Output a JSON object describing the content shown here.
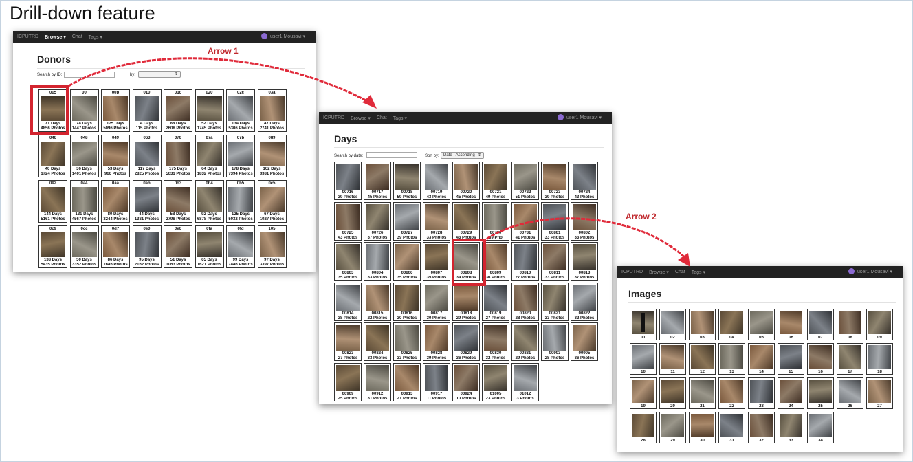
{
  "slide": {
    "title": "Drill-down feature",
    "arrow1": "Arrow 1",
    "arrow2": "Arrow 2"
  },
  "nav": {
    "brand": "ICPUTRD",
    "browse": "Browse ▾",
    "chat": "Chat",
    "tags": "Tags ▾",
    "user": "user1 Mousavi ▾"
  },
  "donors": {
    "title": "Donors",
    "search_label": "Search by ID:",
    "sort_label": "by:",
    "items": [
      {
        "id": "005",
        "days": "71 Days",
        "photos": "4856 Photos"
      },
      {
        "id": "00",
        "days": "74 Days",
        "photos": "1447 Photos"
      },
      {
        "id": "00b",
        "days": "175 Days",
        "photos": "5096 Photos"
      },
      {
        "id": "010",
        "days": "4 Days",
        "photos": "115 Photos"
      },
      {
        "id": "01c",
        "days": "88 Days",
        "photos": "2608 Photos"
      },
      {
        "id": "020",
        "days": "52 Days",
        "photos": "1745 Photos"
      },
      {
        "id": "02c",
        "days": "134 Days",
        "photos": "5306 Photos"
      },
      {
        "id": "03a",
        "days": "47 Days",
        "photos": "2741 Photos"
      },
      {
        "id": "046",
        "days": "40 Days",
        "photos": "1724 Photos"
      },
      {
        "id": "048",
        "days": "36 Days",
        "photos": "1401 Photos"
      },
      {
        "id": "049",
        "days": "53 Days",
        "photos": "966 Photos"
      },
      {
        "id": "063",
        "days": "117 Days",
        "photos": "2825 Photos"
      },
      {
        "id": "070",
        "days": "175 Days",
        "photos": "5631 Photos"
      },
      {
        "id": "07a",
        "days": "64 Days",
        "photos": "1832 Photos"
      },
      {
        "id": "07b",
        "days": "178 Days",
        "photos": "7394 Photos"
      },
      {
        "id": "089",
        "days": "102 Days",
        "photos": "3381 Photos"
      },
      {
        "id": "092",
        "days": "144 Days",
        "photos": "5161 Photos"
      },
      {
        "id": "0a4",
        "days": "131 Days",
        "photos": "4567 Photos"
      },
      {
        "id": "0aa",
        "days": "80 Days",
        "photos": "3244 Photos"
      },
      {
        "id": "0ab",
        "days": "44 Days",
        "photos": "1381 Photos"
      },
      {
        "id": "0b3",
        "days": "58 Days",
        "photos": "2798 Photos"
      },
      {
        "id": "0b4",
        "days": "92 Days",
        "photos": "6878 Photos"
      },
      {
        "id": "0b5",
        "days": "125 Days",
        "photos": "5032 Photos"
      },
      {
        "id": "0c5",
        "days": "67 Days",
        "photos": "1027 Photos"
      },
      {
        "id": "0c9",
        "days": "138 Days",
        "photos": "5435 Photos"
      },
      {
        "id": "0cc",
        "days": "50 Days",
        "photos": "3352 Photos"
      },
      {
        "id": "0d7",
        "days": "86 Days",
        "photos": "1645 Photos"
      },
      {
        "id": "0e0",
        "days": "95 Days",
        "photos": "2162 Photos"
      },
      {
        "id": "0e6",
        "days": "51 Days",
        "photos": "1063 Photos"
      },
      {
        "id": "0fa",
        "days": "65 Days",
        "photos": "1621 Photos"
      },
      {
        "id": "0fd",
        "days": "99 Days",
        "photos": "7446 Photos"
      },
      {
        "id": "105",
        "days": "97 Days",
        "photos": "3397 Photos"
      }
    ]
  },
  "days": {
    "title": "Days",
    "search_label": "Search by date:",
    "sort_label": "Sort by:",
    "sort_value": "Date - Ascending",
    "items": [
      {
        "date": "00716",
        "photos": "39 Photos"
      },
      {
        "date": "00717",
        "photos": "45 Photos"
      },
      {
        "date": "00718",
        "photos": "59 Photos"
      },
      {
        "date": "00719",
        "photos": "43 Photos"
      },
      {
        "date": "00720",
        "photos": "45 Photos"
      },
      {
        "date": "00721",
        "photos": "49 Photos"
      },
      {
        "date": "00722",
        "photos": "51 Photos"
      },
      {
        "date": "00723",
        "photos": "39 Photos"
      },
      {
        "date": "00724",
        "photos": "43 Photos"
      },
      {
        "date": "00725",
        "photos": "43 Photos"
      },
      {
        "date": "00726",
        "photos": "37 Photos"
      },
      {
        "date": "00727",
        "photos": "39 Photos"
      },
      {
        "date": "00728",
        "photos": "33 Photos"
      },
      {
        "date": "00729",
        "photos": "43 Photos"
      },
      {
        "date": "00730",
        "photos": "39 Pho"
      },
      {
        "date": "00731",
        "photos": "41 Photos"
      },
      {
        "date": "00801",
        "photos": "33 Photos"
      },
      {
        "date": "00802",
        "photos": "33 Photos"
      },
      {
        "date": "00803",
        "photos": "35 Photos"
      },
      {
        "date": "00804",
        "photos": "33 Photos"
      },
      {
        "date": "00806",
        "photos": "35 Photos"
      },
      {
        "date": "00807",
        "photos": "35 Photos"
      },
      {
        "date": "00808",
        "photos": "34 Photos"
      },
      {
        "date": "00809",
        "photos": "36 Photos"
      },
      {
        "date": "00810",
        "photos": "27 Photos"
      },
      {
        "date": "00811",
        "photos": "33 Photos"
      },
      {
        "date": "00813",
        "photos": "37 Photos"
      },
      {
        "date": "00814",
        "photos": "38 Photos"
      },
      {
        "date": "00815",
        "photos": "22 Photos"
      },
      {
        "date": "00816",
        "photos": "30 Photos"
      },
      {
        "date": "00817",
        "photos": "30 Photos"
      },
      {
        "date": "00818",
        "photos": "29 Photos"
      },
      {
        "date": "00819",
        "photos": "27 Photos"
      },
      {
        "date": "00820",
        "photos": "28 Photos"
      },
      {
        "date": "00821",
        "photos": "33 Photos"
      },
      {
        "date": "00822",
        "photos": "32 Photos"
      },
      {
        "date": "00823",
        "photos": "27 Photos"
      },
      {
        "date": "00824",
        "photos": "33 Photos"
      },
      {
        "date": "00825",
        "photos": "33 Photos"
      },
      {
        "date": "00828",
        "photos": "39 Photos"
      },
      {
        "date": "00829",
        "photos": "36 Photos"
      },
      {
        "date": "00830",
        "photos": "32 Photos"
      },
      {
        "date": "00831",
        "photos": "29 Photos"
      },
      {
        "date": "00903",
        "photos": "28 Photos"
      },
      {
        "date": "00905",
        "photos": "36 Photos"
      },
      {
        "date": "00909",
        "photos": "25 Photos"
      },
      {
        "date": "00912",
        "photos": "31 Photos"
      },
      {
        "date": "00913",
        "photos": "21 Photos"
      },
      {
        "date": "00917",
        "photos": "11 Photos"
      },
      {
        "date": "00924",
        "photos": "10 Photos"
      },
      {
        "date": "01005",
        "photos": "23 Photos"
      },
      {
        "date": "01012",
        "photos": "3 Photos"
      }
    ]
  },
  "images": {
    "title": "Images",
    "items": [
      "01",
      "02",
      "03",
      "04",
      "05",
      "06",
      "07",
      "08",
      "09",
      "10",
      "11",
      "12",
      "13",
      "14",
      "15",
      "16",
      "17",
      "18",
      "19",
      "20",
      "21",
      "22",
      "23",
      "24",
      "25",
      "26",
      "27",
      "28",
      "29",
      "30",
      "31",
      "32",
      "33",
      "34"
    ]
  },
  "colors": {
    "accent": "#d3242f",
    "navbar": "#222222"
  }
}
